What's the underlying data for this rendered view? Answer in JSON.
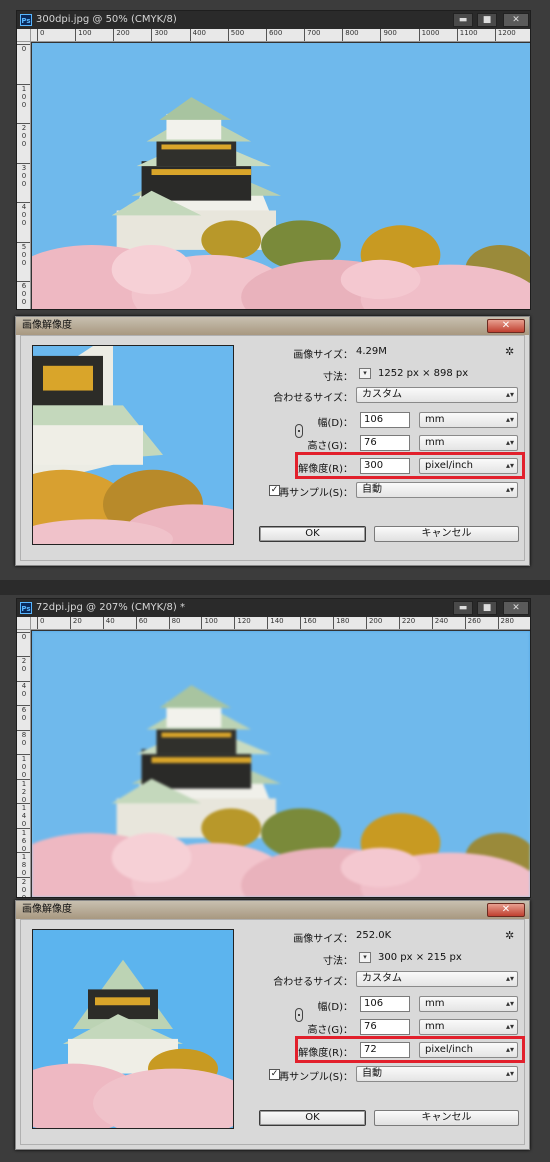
{
  "windows": [
    {
      "doc_title": "300dpi.jpg @ 50% (CMYK/8)",
      "ruler_h": [
        "0",
        "100",
        "200",
        "300",
        "400",
        "500",
        "600",
        "700",
        "800",
        "900",
        "1000",
        "1100",
        "1200"
      ],
      "ruler_v": [
        "0",
        "1 0 0",
        "2 0 0",
        "3 0 0",
        "4 0 0",
        "5 0 0",
        "6 0 0"
      ],
      "dialog": {
        "title": "画像解像度",
        "image_size_label": "画像サイズ：",
        "image_size_value": "4.29M",
        "dimensions_label": "寸法：",
        "dimensions_value": "1252 px × 898 px",
        "fit_label": "合わせるサイズ：",
        "fit_value": "カスタム",
        "width_label": "幅(D)：",
        "width_value": "106",
        "width_unit": "mm",
        "height_label": "高さ(G)：",
        "height_value": "76",
        "height_unit": "mm",
        "resolution_label": "解像度(R)：",
        "resolution_value": "300",
        "resolution_unit": "pixel/inch",
        "resample_label": "再サンプル(S)：",
        "resample_value": "自動",
        "ok_label": "OK",
        "cancel_label": "キャンセル"
      }
    },
    {
      "doc_title": "72dpi.jpg @ 207% (CMYK/8) *",
      "ruler_h": [
        "0",
        "20",
        "40",
        "60",
        "80",
        "100",
        "120",
        "140",
        "160",
        "180",
        "200",
        "220",
        "240",
        "260",
        "280"
      ],
      "ruler_v": [
        "0",
        "2 0",
        "4 0",
        "6 0",
        "8 0",
        "1 0 0",
        "1 2 0",
        "1 4 0",
        "1 6 0",
        "1 8 0",
        "2 0 0"
      ],
      "dialog": {
        "title": "画像解像度",
        "image_size_label": "画像サイズ：",
        "image_size_value": "252.0K",
        "dimensions_label": "寸法：",
        "dimensions_value": "300 px × 215 px",
        "fit_label": "合わせるサイズ：",
        "fit_value": "カスタム",
        "width_label": "幅(D)：",
        "width_value": "106",
        "width_unit": "mm",
        "height_label": "高さ(G)：",
        "height_value": "76",
        "height_unit": "mm",
        "resolution_label": "解像度(R)：",
        "resolution_value": "72",
        "resolution_unit": "pixel/inch",
        "resample_label": "再サンプル(S)：",
        "resample_value": "自動",
        "ok_label": "OK",
        "cancel_label": "キャンセル"
      }
    }
  ],
  "icons": {
    "ps_logo": "Ps",
    "minimize": "▬",
    "maximize": "■",
    "close": "✕",
    "gear": "✲",
    "dropdown": "▾",
    "checkbox": "✓"
  },
  "colors": {
    "highlight": "#e2202c",
    "sky": "#6fbbee",
    "blossom": "#f2bcc6"
  }
}
